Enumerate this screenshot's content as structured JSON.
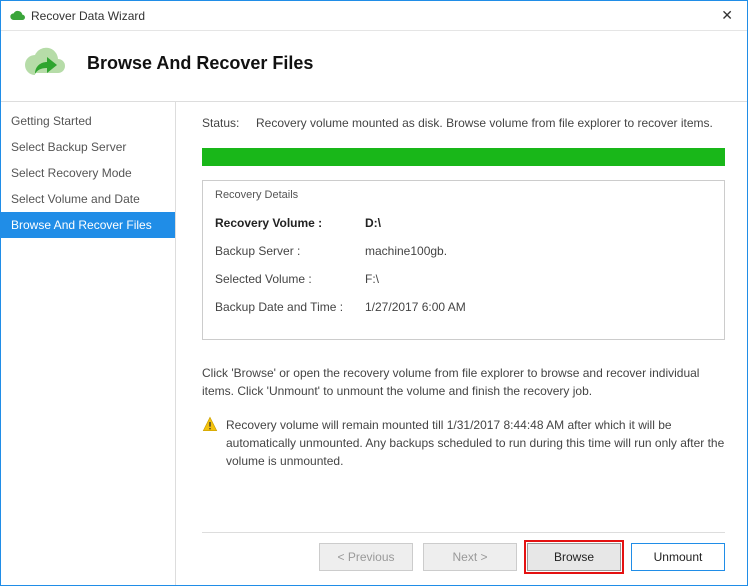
{
  "window": {
    "title": "Recover Data Wizard"
  },
  "header": {
    "title": "Browse And Recover Files"
  },
  "sidebar": {
    "items": [
      {
        "label": "Getting Started"
      },
      {
        "label": "Select Backup Server"
      },
      {
        "label": "Select Recovery Mode"
      },
      {
        "label": "Select Volume and Date"
      },
      {
        "label": "Browse And Recover Files"
      }
    ]
  },
  "status": {
    "label": "Status:",
    "text": "Recovery volume mounted as disk. Browse volume from file explorer to recover items."
  },
  "details": {
    "title": "Recovery Details",
    "rows": [
      {
        "label": "Recovery Volume :",
        "value": "D:\\"
      },
      {
        "label": "Backup Server :",
        "value": "machine100gb."
      },
      {
        "label": "Selected Volume :",
        "value": "F:\\"
      },
      {
        "label": "Backup Date and Time :",
        "value": "1/27/2017 6:00 AM"
      }
    ]
  },
  "instructions": "Click 'Browse' or open the recovery volume from file explorer to browse and recover individual items. Click 'Unmount' to unmount the volume and finish the recovery job.",
  "warning": "Recovery volume will remain mounted till 1/31/2017 8:44:48 AM after which it will be automatically unmounted. Any backups scheduled to run during this time will run only after the volume is unmounted.",
  "buttons": {
    "previous": "< Previous",
    "next": "Next >",
    "browse": "Browse",
    "unmount": "Unmount"
  }
}
